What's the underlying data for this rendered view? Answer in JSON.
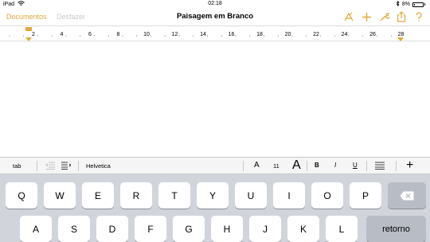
{
  "status_bar": {
    "carrier": "iPad",
    "time": "02:18",
    "battery_percent": "8%"
  },
  "nav": {
    "documents_label": "Documentos",
    "undo_label": "Desfazer",
    "title": "Paisagem em Branco",
    "icons": [
      "brush-icon",
      "plus-icon",
      "wrench-icon",
      "share-icon",
      "help-icon"
    ],
    "accent_color": "#e3a73c"
  },
  "ruler": {
    "labels": [
      "2",
      "4",
      "6",
      "8",
      "10",
      "12",
      "14",
      "16",
      "18",
      "20",
      "22",
      "24",
      "26",
      "28"
    ]
  },
  "format_toolbar": {
    "tab_label": "tab",
    "font_name": "Helvetica",
    "font_size": "11",
    "smaller_label": "A",
    "larger_label": "A",
    "bold_label": "B",
    "italic_label": "I",
    "underline_label": "U",
    "insert_label": "+"
  },
  "keyboard": {
    "row1": [
      "Q",
      "W",
      "E",
      "R",
      "T",
      "Y",
      "U",
      "I",
      "O",
      "P"
    ],
    "row2": [
      "A",
      "S",
      "D",
      "F",
      "G",
      "H",
      "J",
      "K",
      "L"
    ],
    "return_label": "retorno"
  }
}
